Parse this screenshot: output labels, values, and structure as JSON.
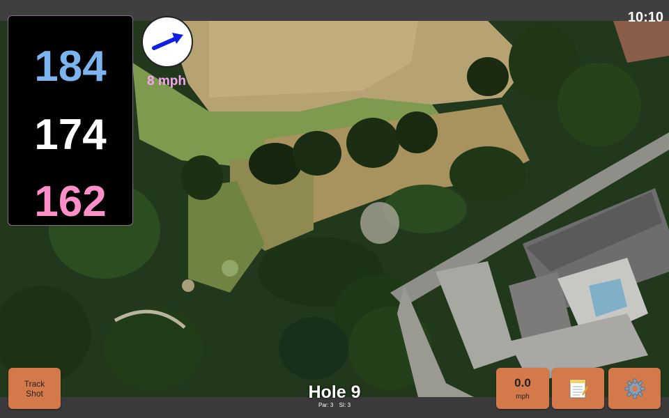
{
  "status": {
    "clock": "10:10"
  },
  "distances": {
    "back": "184",
    "middle": "174",
    "front": "162"
  },
  "wind": {
    "label": "8 mph",
    "icon": "wind-direction-arrow-icon"
  },
  "buttons": {
    "track_shot_line1": "Track",
    "track_shot_line2": "Shot",
    "wind_speed_value": "0.0",
    "wind_speed_unit": "mph",
    "notes_icon": "notepad-icon",
    "settings_icon": "gear-icon"
  },
  "hole": {
    "title": "Hole 9",
    "par": "Par: 3",
    "si": "SI: 3"
  },
  "colors": {
    "back_distance": "#7cb4f0",
    "middle_distance": "#ffffff",
    "front_distance": "#ff8fc8",
    "button": "#d47a4a",
    "wind_label": "#f5a6f0"
  }
}
